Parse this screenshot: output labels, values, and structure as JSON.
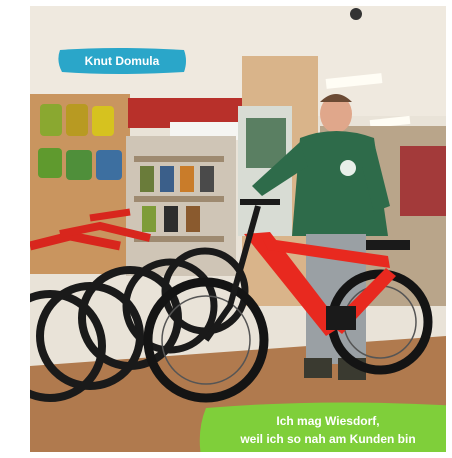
{
  "name_tag": "Knut Domula",
  "caption": {
    "line1": "Ich mag Wiesdorf,",
    "line2": "weil ich so nah am Kunden bin"
  },
  "colors": {
    "name_tag_bg": "#2aa6c9",
    "caption_bg": "#7fcf3a",
    "bike_frame": "#e8291f",
    "jacket": "#2e6b4a",
    "wall": "#d9b48a"
  }
}
